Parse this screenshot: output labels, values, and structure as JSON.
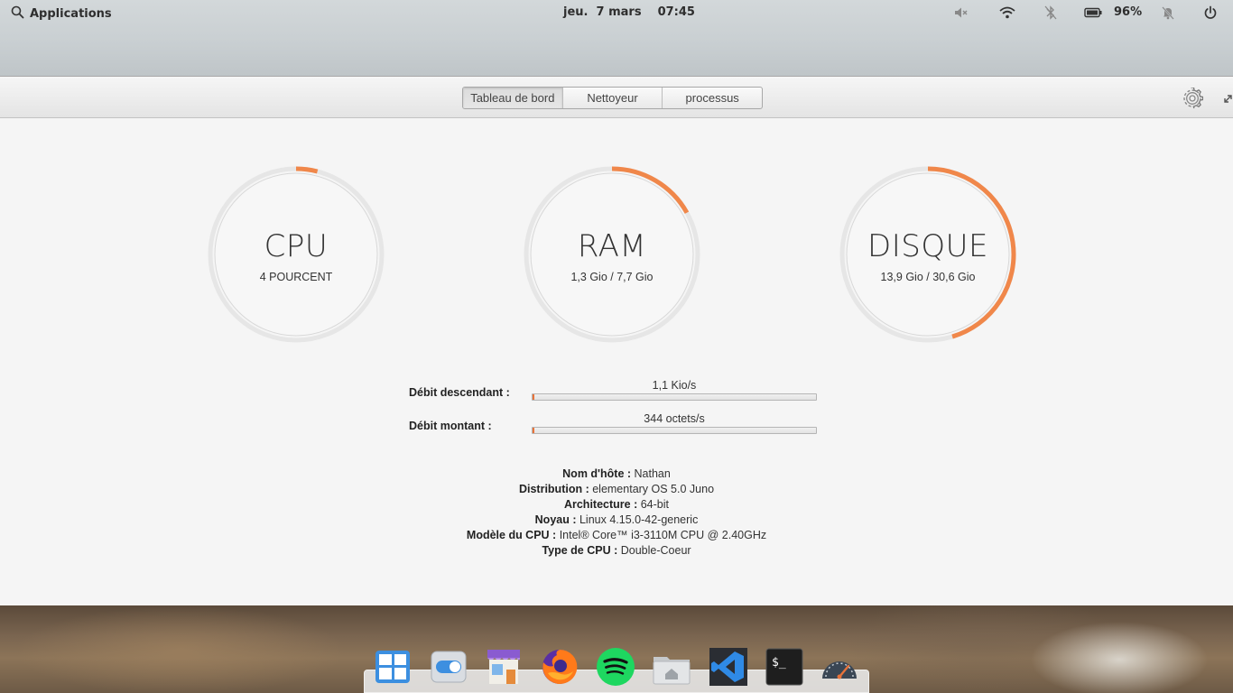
{
  "panel": {
    "applications_label": "Applications",
    "date": "jeu.  7 mars",
    "time": "07:45",
    "battery_percent": "96%",
    "tray_icons": [
      "volume-muted-icon",
      "wifi-icon",
      "bluetooth-off-icon",
      "battery-icon",
      "notifications-off-icon",
      "power-icon"
    ]
  },
  "header": {
    "tabs": [
      {
        "label": "Tableau de bord",
        "active": true
      },
      {
        "label": "Nettoyeur",
        "active": false
      },
      {
        "label": "processus",
        "active": false
      }
    ]
  },
  "gauges": [
    {
      "title": "CPU",
      "subtitle": "4 POURCENT",
      "fraction": 0.04
    },
    {
      "title": "RAM",
      "subtitle": "1,3 Gio / 7,7 Gio",
      "fraction": 0.169
    },
    {
      "title": "DISQUE",
      "subtitle": "13,9 Gio / 30,6 Gio",
      "fraction": 0.454
    }
  ],
  "network": {
    "download": {
      "label": "Débit descendant :",
      "value": "1,1 Kio/s",
      "fraction": 0.005
    },
    "upload": {
      "label": "Débit montant :",
      "value": "344 octets/s",
      "fraction": 0.005
    }
  },
  "system_info": [
    {
      "key": "Nom d'hôte :",
      "value": "Nathan"
    },
    {
      "key": "Distribution :",
      "value": "elementary OS 5.0 Juno"
    },
    {
      "key": "Architecture :",
      "value": "64-bit"
    },
    {
      "key": "Noyau :",
      "value": "Linux 4.15.0-42-generic"
    },
    {
      "key": "Modèle du CPU :",
      "value": "Intel® Core™ i3-3110M CPU @ 2.40GHz"
    },
    {
      "key": "Type de CPU :",
      "value": "Double-Coeur"
    }
  ],
  "dock": {
    "apps": [
      "multitasking-view-icon",
      "system-settings-icon",
      "appcenter-icon",
      "firefox-icon",
      "spotify-icon",
      "files-icon",
      "vscode-icon",
      "terminal-icon",
      "system-monitor-icon"
    ]
  },
  "colors": {
    "accent": "#f0874a",
    "track": "#e6e6e6"
  }
}
